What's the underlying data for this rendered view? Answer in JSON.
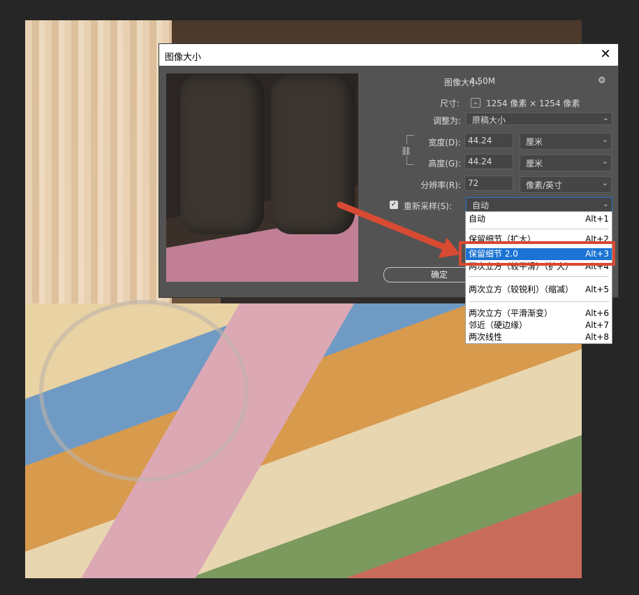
{
  "dialog": {
    "title": "图像大小",
    "close": "✕",
    "image_size_label": "图像大小:",
    "image_size_value": "4.50M",
    "gear": "⚙",
    "dimensions_label": "尺寸:",
    "dimensions_value": "1254 像素  ×  1254 像素",
    "fit_to_label": "调整为:",
    "fit_to_value": "原稿大小",
    "width_label": "宽度(D):",
    "width_value": "44.24",
    "width_unit": "厘米",
    "height_label": "高度(G):",
    "height_value": "44.24",
    "height_unit": "厘米",
    "resolution_label": "分辨率(R):",
    "resolution_value": "72",
    "resolution_unit": "像素/英寸",
    "resample_label": "重新采样(S):",
    "resample_value": "自动",
    "ok_label": "确定"
  },
  "dropdown": {
    "options": [
      {
        "label": "自动",
        "shortcut": "Alt+1"
      },
      {
        "label": "保留细节（扩大）",
        "shortcut": "Alt+2"
      },
      {
        "label": "保留细节 2.0",
        "shortcut": "Alt+3"
      },
      {
        "label": "两次立方（较平滑）（扩大）",
        "shortcut": "Alt+4"
      },
      {
        "label": "两次立方（较锐利）（缩减）",
        "shortcut": "Alt+5"
      },
      {
        "label": "两次立方（平滑渐变）",
        "shortcut": "Alt+6"
      },
      {
        "label": "邻近（硬边缘）",
        "shortcut": "Alt+7"
      },
      {
        "label": "两次线性",
        "shortcut": "Alt+8"
      }
    ],
    "selected_index": 2
  },
  "colors": {
    "highlight": "#1b73d3",
    "annotation": "#d84a32"
  }
}
